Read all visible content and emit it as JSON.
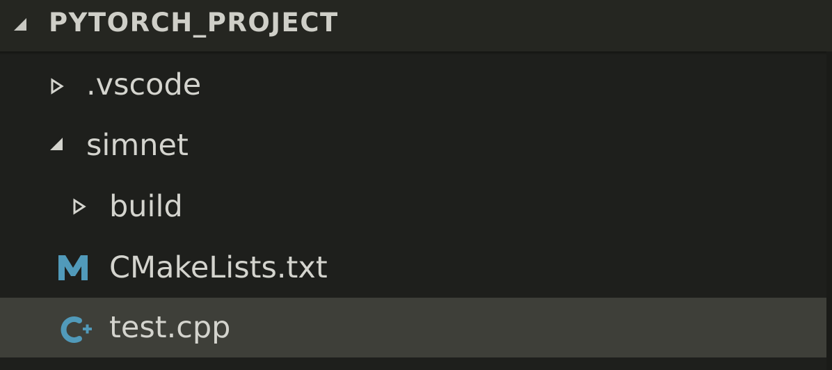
{
  "explorer": {
    "project_title": "PYTORCH_PROJECT",
    "items": [
      {
        "label": ".vscode",
        "kind": "folder",
        "expanded": false,
        "icon": "chevron-right-icon"
      },
      {
        "label": "simnet",
        "kind": "folder",
        "expanded": true,
        "icon": "chevron-down-icon"
      },
      {
        "label": "build",
        "kind": "folder",
        "expanded": false,
        "icon": "chevron-right-icon"
      },
      {
        "label": "CMakeLists.txt",
        "kind": "file",
        "icon": "cmake-file-icon",
        "icon_color": "#519aba"
      },
      {
        "label": "test.cpp",
        "kind": "file",
        "icon": "cpp-file-icon",
        "icon_color": "#519aba",
        "selected": true
      }
    ]
  },
  "colors": {
    "background": "#1e1f1c",
    "header_background": "#252621",
    "selected_row": "#3e3f39",
    "text": "#d4d4ce",
    "accent": "#519aba"
  }
}
